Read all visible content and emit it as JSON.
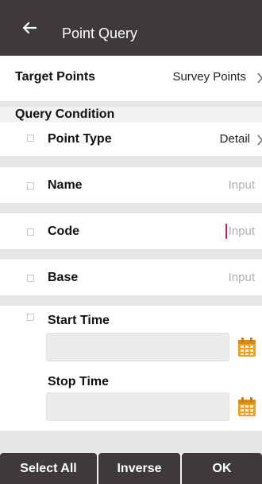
{
  "header": {
    "title": "Point Query",
    "back_icon": "arrow-left-icon"
  },
  "target": {
    "label": "Target Points",
    "value": "Survey Points"
  },
  "query_condition": {
    "label": "Query Condition"
  },
  "fields": {
    "point_type": {
      "label": "Point Type",
      "value": "Detail"
    },
    "name": {
      "label": "Name",
      "placeholder": "Input"
    },
    "code": {
      "label": "Code",
      "placeholder": "Input"
    },
    "base": {
      "label": "Base",
      "placeholder": "Input"
    },
    "start_time": {
      "label": "Start Time"
    },
    "stop_time": {
      "label": "Stop Time"
    }
  },
  "buttons": {
    "select_all": "Select All",
    "inverse": "Inverse",
    "ok": "OK"
  },
  "colors": {
    "appbar": "#3d3a39",
    "accent_calendar": "#f0a020",
    "caret": "#d81b60"
  }
}
